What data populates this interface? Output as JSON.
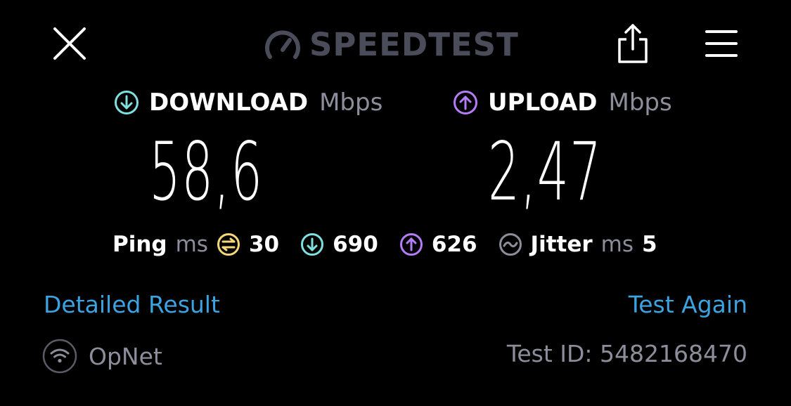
{
  "header": {
    "brand": "SPEEDTEST",
    "close_icon": "close-icon",
    "share_icon": "share-icon",
    "menu_icon": "hamburger-menu-icon"
  },
  "download": {
    "label": "DOWNLOAD",
    "unit": "Mbps",
    "value": "58,6",
    "color": "#7fe0e0"
  },
  "upload": {
    "label": "UPLOAD",
    "unit": "Mbps",
    "value": "2,47",
    "color": "#b47cf5"
  },
  "latency": {
    "ping_label": "Ping",
    "ping_unit": "ms",
    "ping_value": "30",
    "ping_color": "#f5d77a",
    "download_latency": "690",
    "upload_latency": "626",
    "jitter_label": "Jitter",
    "jitter_unit": "ms",
    "jitter_value": "5"
  },
  "actions": {
    "detailed_result": "Detailed Result",
    "test_again": "Test Again"
  },
  "footer": {
    "provider": "OpNet",
    "test_id": "Test ID: 5482168470"
  },
  "colors": {
    "link": "#3aa3e0",
    "muted": "#8d8e9b",
    "background": "#000000"
  }
}
